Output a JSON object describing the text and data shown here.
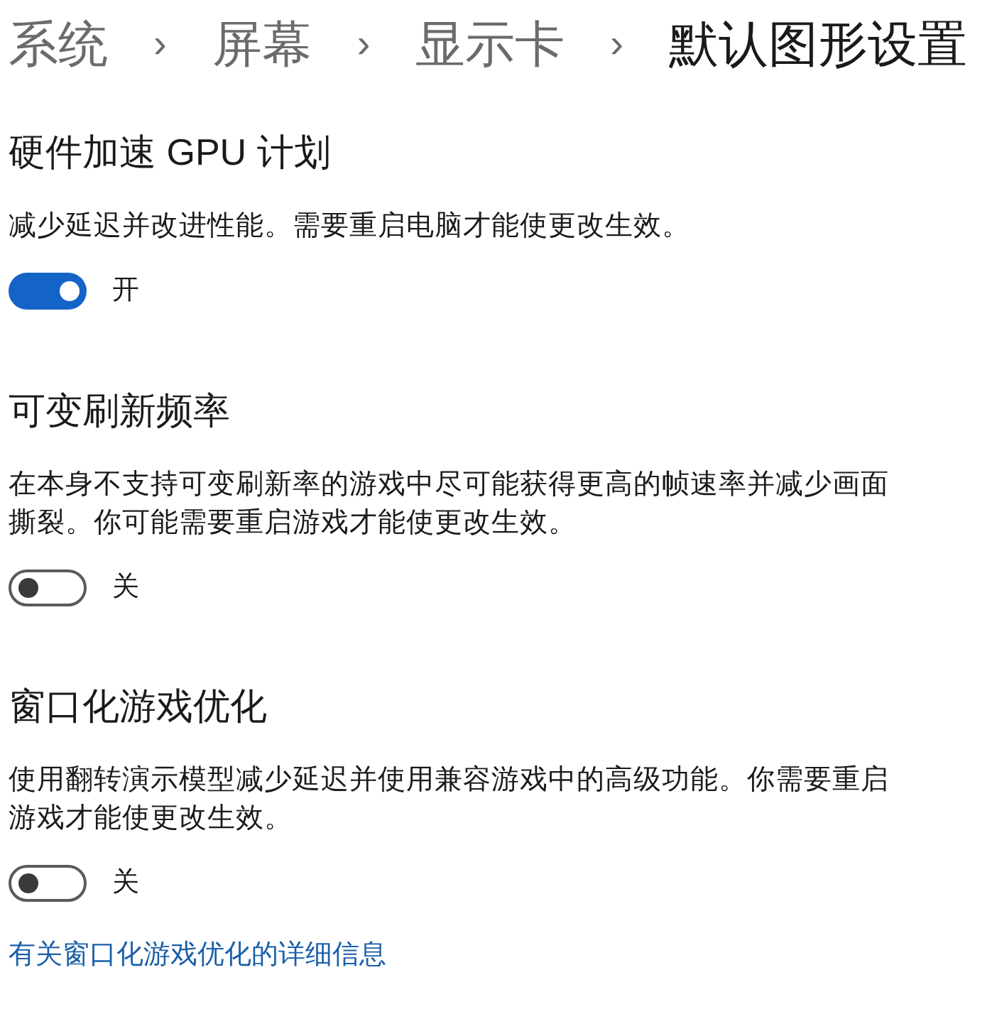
{
  "breadcrumb": [
    {
      "kind": "crumb",
      "label": "系统",
      "current": false
    },
    {
      "kind": "separator",
      "label": "›"
    },
    {
      "kind": "crumb",
      "label": "屏幕",
      "current": false
    },
    {
      "kind": "separator",
      "label": "›"
    },
    {
      "kind": "crumb",
      "label": "显示卡",
      "current": false
    },
    {
      "kind": "separator",
      "label": "›"
    },
    {
      "kind": "crumb",
      "label": "默认图形设置",
      "current": true
    }
  ],
  "sections": [
    {
      "title": "硬件加速 GPU 计划",
      "description": "减少延迟并改进性能。需要重启电脑才能使更改生效。",
      "toggle": {
        "on": true,
        "label": "开"
      }
    },
    {
      "title": "可变刷新频率",
      "description": "在本身不支持可变刷新率的游戏中尽可能获得更高的帧速率并减少画面撕裂。你可能需要重启游戏才能使更改生效。",
      "toggle": {
        "on": false,
        "label": "关"
      }
    },
    {
      "title": "窗口化游戏优化",
      "description": "使用翻转演示模型减少延迟并使用兼容游戏中的高级功能。你需要重启游戏才能使更改生效。",
      "toggle": {
        "on": false,
        "label": "关"
      }
    }
  ],
  "link": "有关窗口化游戏优化的详细信息"
}
